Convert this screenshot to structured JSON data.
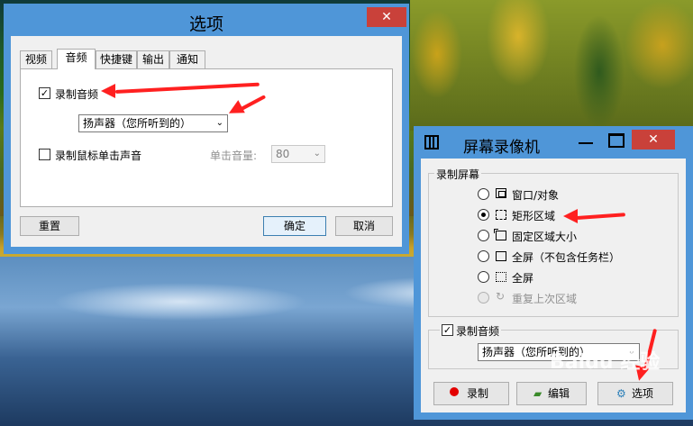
{
  "options_dialog": {
    "title": "选项",
    "close_glyph": "✕",
    "tabs": [
      "视频",
      "音频",
      "快捷键",
      "输出",
      "通知"
    ],
    "active_tab": "音频",
    "record_audio": {
      "label": "录制音频",
      "checked": true
    },
    "audio_source": {
      "value": "扬声器（您所听到的）"
    },
    "record_click_sound": {
      "label": "录制鼠标单击声音",
      "checked": false
    },
    "click_volume": {
      "label": "单击音量:",
      "value": "80"
    },
    "buttons": {
      "reset": "重置",
      "ok": "确定",
      "cancel": "取消"
    }
  },
  "recorder": {
    "title": "屏幕录像机",
    "close_glyph": "✕",
    "area_group": {
      "title": "录制屏幕",
      "options": [
        {
          "label": "窗口/对象",
          "icon": "window-icon",
          "checked": false,
          "disabled": false
        },
        {
          "label": "矩形区域",
          "icon": "dashed-rect-icon",
          "checked": true,
          "disabled": false
        },
        {
          "label": "固定区域大小",
          "icon": "fixed-region-icon",
          "checked": false,
          "disabled": false
        },
        {
          "label": "全屏（不包含任务栏）",
          "icon": "monitor-icon",
          "checked": false,
          "disabled": false
        },
        {
          "label": "全屏",
          "icon": "fullscreen-icon",
          "checked": false,
          "disabled": false
        },
        {
          "label": "重复上次区域",
          "icon": "repeat-icon",
          "checked": false,
          "disabled": true
        }
      ]
    },
    "audio_group": {
      "title": "录制音频",
      "checked": true,
      "source": "扬声器（您所听到的）"
    },
    "buttons": {
      "record": "录制",
      "edit": "编辑",
      "options": "选项"
    }
  },
  "watermark": "Baidu 经验",
  "colors": {
    "titlebar": "#4f96d8",
    "close": "#c9413a",
    "annotation": "#ff2020",
    "record_dot": "#e30000"
  }
}
